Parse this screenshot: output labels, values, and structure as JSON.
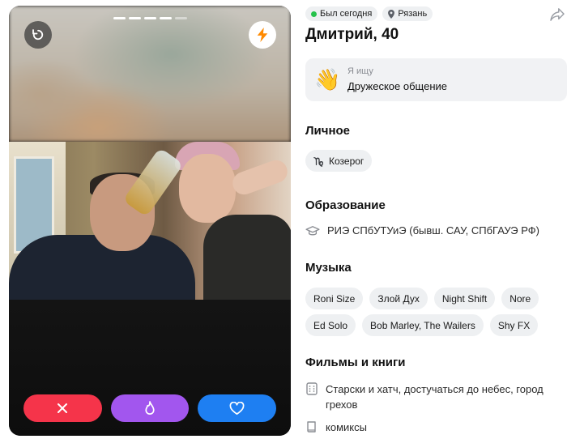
{
  "status": {
    "online_label": "Был сегодня",
    "city": "Рязань",
    "online_color": "#27c24c"
  },
  "profile": {
    "name_age": "Дмитрий, 40"
  },
  "looking_for": {
    "emoji": "👋",
    "label": "Я ищу",
    "value": "Дружеское общение"
  },
  "personal": {
    "title": "Личное",
    "zodiac": "Козерог",
    "zodiac_icon": "capricorn-icon"
  },
  "education": {
    "title": "Образование",
    "value": "РИЭ СПбУТУиЭ (бывш. САУ, СПбГАУЭ РФ)",
    "icon": "graduation-cap-icon"
  },
  "music": {
    "title": "Музыка",
    "artists": [
      "Roni Size",
      "Злой Дух",
      "Night Shift",
      "Nore",
      "Ed Solo",
      "Bob Marley, The Wailers",
      "Shy FX"
    ]
  },
  "movies_books": {
    "title": "Фильмы и книги",
    "movies": "Старски и хатч, достучаться до небес, город грехов",
    "books": "комиксы"
  },
  "photo": {
    "total": 5,
    "current": 4
  },
  "actions": {
    "dislike_color": "#f5344a",
    "super_color": "#a256ee",
    "like_color": "#1e7ff2",
    "icons": [
      "close-icon",
      "flame-icon",
      "heart-icon"
    ]
  }
}
